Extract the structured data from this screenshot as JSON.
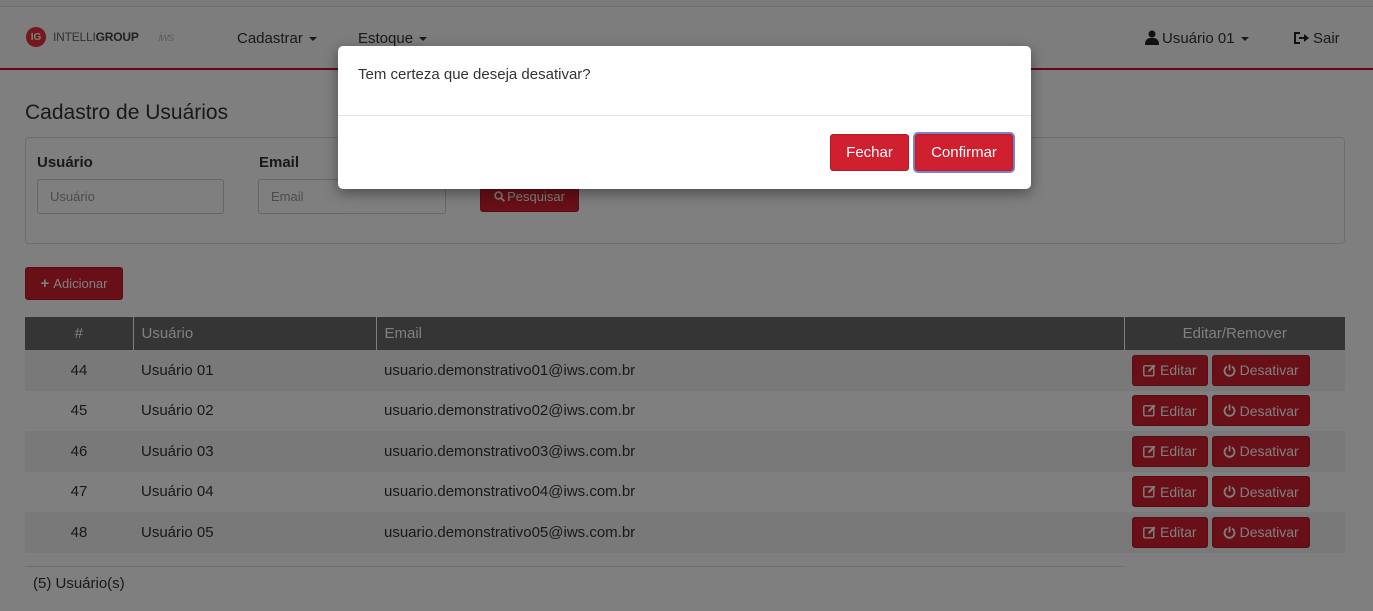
{
  "navbar": {
    "logo_badge": "IG",
    "brand_light": "INTELLI",
    "brand_bold": "GROUP",
    "brand_mark": "iws",
    "menu": [
      {
        "label": "Cadastrar"
      },
      {
        "label": "Estoque"
      }
    ],
    "user_label": "Usuário 01",
    "logout_label": "Sair"
  },
  "page": {
    "title": "Cadastro de Usuários"
  },
  "filters": {
    "user_label": "Usuário",
    "user_placeholder": "Usuário",
    "email_label": "Email",
    "email_placeholder": "Email",
    "search_label": "Pesquisar"
  },
  "add_button_label": "Adicionar",
  "table": {
    "headers": {
      "id": "#",
      "user": "Usuário",
      "email": "Email",
      "actions": "Editar/Remover"
    },
    "rows": [
      {
        "id": "44",
        "user": "Usuário 01",
        "email": "usuario.demonstrativo01@iws.com.br"
      },
      {
        "id": "45",
        "user": "Usuário 02",
        "email": "usuario.demonstrativo02@iws.com.br"
      },
      {
        "id": "46",
        "user": "Usuário 03",
        "email": "usuario.demonstrativo03@iws.com.br"
      },
      {
        "id": "47",
        "user": "Usuário 04",
        "email": "usuario.demonstrativo04@iws.com.br"
      },
      {
        "id": "48",
        "user": "Usuário 05",
        "email": "usuario.demonstrativo05@iws.com.br"
      }
    ],
    "edit_label": "Editar",
    "deactivate_label": "Desativar"
  },
  "footer": {
    "count_label": "(5) Usuário(s)"
  },
  "modal": {
    "message": "Tem certeza que deseja desativar?",
    "close_label": "Fechar",
    "confirm_label": "Confirmar"
  },
  "colors": {
    "accent_red": "#d01f2e",
    "header_gray": "#6b6b6b"
  },
  "icons": {
    "user": "user-icon",
    "logout": "sign-out-icon",
    "search": "search-icon",
    "add": "plus-icon",
    "edit": "edit-icon",
    "deactivate": "power-icon"
  }
}
